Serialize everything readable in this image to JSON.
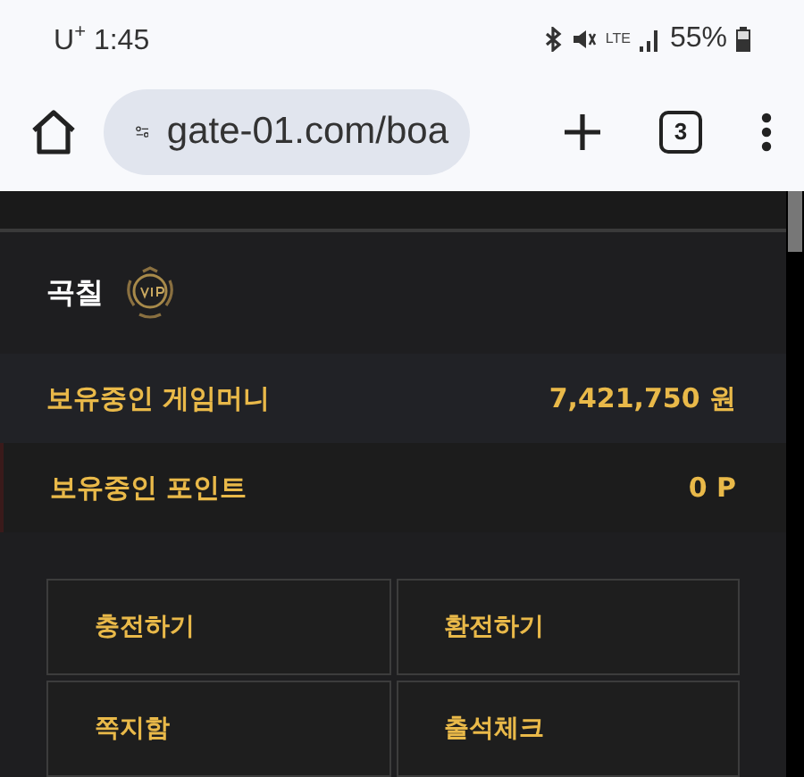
{
  "status_bar": {
    "carrier_time": "U$^{+}$ 1:45",
    "network": "LTE",
    "battery": "55%"
  },
  "browser": {
    "url": "gate-01.com/boa",
    "tab_count": "3"
  },
  "account": {
    "username": "곡칠",
    "balances": [
      {
        "label": "보유중인 게임머니",
        "value": "7,421,750 원"
      },
      {
        "label": "보유중인 포인트",
        "value": "0 P"
      }
    ],
    "actions": [
      "충전하기",
      "환전하기",
      "쪽지함",
      "출석체크"
    ]
  }
}
